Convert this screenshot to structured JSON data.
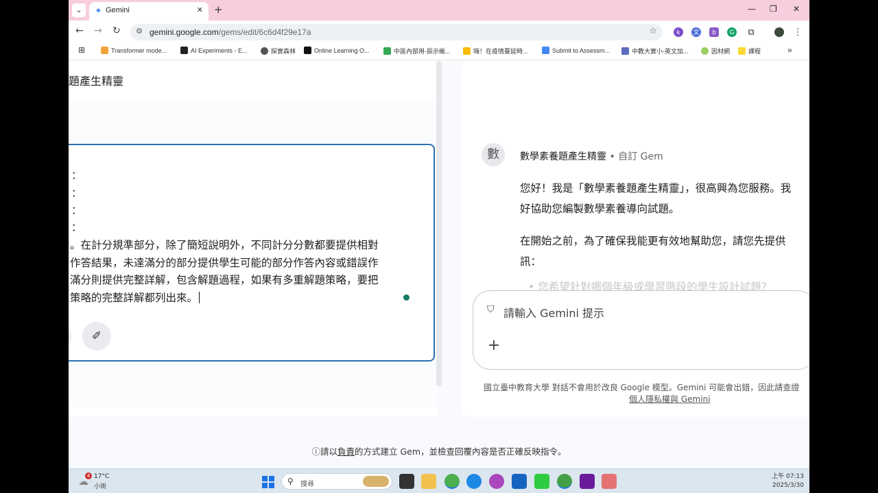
{
  "browser": {
    "tab_title": "Gemini",
    "url_host": "gemini.google.com",
    "url_path": "/gems/edit/6c6d4f29e17a",
    "bookmarks": [
      "Transformer mode...",
      "AI Experiments - E...",
      "探實森林",
      "Online Learning O...",
      "中區內部用-辰示帳...",
      "嗨！在疫情蔓延時...",
      "Submit to Assessm...",
      "中教大實小-英文加...",
      "因材網",
      "課程"
    ],
    "extension_labels": [
      "k",
      "b"
    ]
  },
  "editor": {
    "gem_title": "題產生精靈",
    "colon_marks": [
      "：",
      "：",
      "：",
      "："
    ],
    "body_text": "。在計分規準部分，除了簡短說明外，不同計分分數都要提供相對\n作答結果，未達滿分的部分提供學生可能的部分作答內容或錯誤作\n滿分則提供完整詳解，包含解題過程，如果有多重解題策略，要把\n策略的完整詳解都列出來。"
  },
  "preview": {
    "avatar_char": "數",
    "gem_name": "數學素養題產生精靈",
    "gem_tag": " • 自訂 Gem",
    "greeting_line1": "您好！我是「數學素養題產生精靈」，很高興為您服務。我",
    "greeting_line2": "好協助您編製數學素養導向試題。",
    "intro_line1": "在開始之前，為了確保我能更有效地幫助您，請您先提供",
    "intro_line2": "訊：",
    "bullet_text": "您希望針對哪個年級或學習階段的學生設計試題？",
    "prompt_placeholder": "請輸入 Gemini 提示",
    "disclaimer": "國立臺中教育大學 對話不會用於改良 Google 模型。Gemini 可能會出錯，因此請查證",
    "privacy_link": "個人隱私權與 Gemini"
  },
  "footer_note": {
    "prefix": "請以",
    "link": "負責",
    "suffix": "的方式建立 Gem，並檢查回覆內容是否正確反映指令。"
  },
  "taskbar": {
    "weather_badge": "4",
    "temperature": "17°C",
    "weather_desc": "小雨",
    "search_placeholder": "搜尋",
    "time": "上午 07:13",
    "date": "2025/3/30"
  }
}
